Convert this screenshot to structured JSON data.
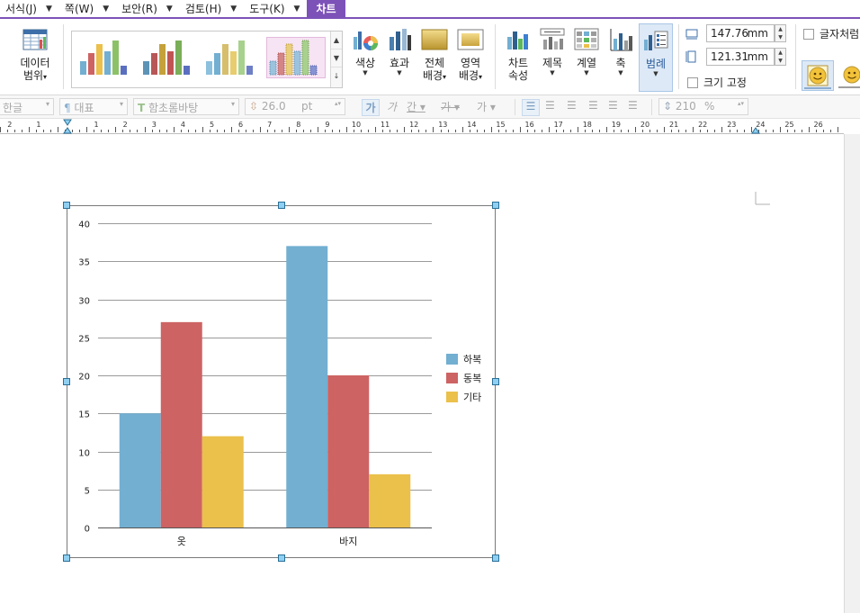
{
  "menubar": {
    "items": [
      "서식(J)",
      "쪽(W)",
      "보안(R)",
      "검토(H)",
      "도구(K)"
    ],
    "active_tab": "차트"
  },
  "ribbon": {
    "data_range": {
      "line1": "데이터",
      "line2": "범위"
    },
    "color": "색상",
    "effect": "효과",
    "bg_all": {
      "line1": "전체",
      "line2": "배경"
    },
    "bg_area": {
      "line1": "영역",
      "line2": "배경"
    },
    "chart_props": {
      "line1": "차트",
      "line2": "속성"
    },
    "title": "제목",
    "series": "계열",
    "axis": "축",
    "legend": "범례",
    "width_value": "147.76",
    "height_value": "121.31",
    "unit": "mm",
    "fixed_size": "크기 고정",
    "wrap_text": "글자처럼"
  },
  "formatbar": {
    "lang": "한글",
    "style": "대표",
    "font": "함초롬바탕",
    "size": "26.0",
    "size_unit": "pt",
    "scale": "210",
    "scale_unit": "%"
  },
  "chart_data": {
    "type": "bar",
    "categories": [
      "옷",
      "바지"
    ],
    "series": [
      {
        "name": "하복",
        "values": [
          15,
          37
        ],
        "color": "#72afd1"
      },
      {
        "name": "동복",
        "values": [
          27,
          20
        ],
        "color": "#cd6363"
      },
      {
        "name": "기타",
        "values": [
          12,
          7
        ],
        "color": "#ebc04b"
      }
    ],
    "ylim": [
      0,
      40
    ],
    "yticks": [
      0,
      5,
      10,
      15,
      20,
      25,
      30,
      35,
      40
    ],
    "grid": true,
    "legend_position": "right"
  },
  "ruler": {
    "labels": [
      "2",
      "1",
      "1",
      "2",
      "3",
      "4",
      "5",
      "6",
      "7",
      "8",
      "9",
      "10",
      "11",
      "12",
      "13",
      "14",
      "15",
      "16",
      "17",
      "18",
      "19",
      "20",
      "21",
      "22",
      "23",
      "24",
      "25",
      "26"
    ]
  }
}
